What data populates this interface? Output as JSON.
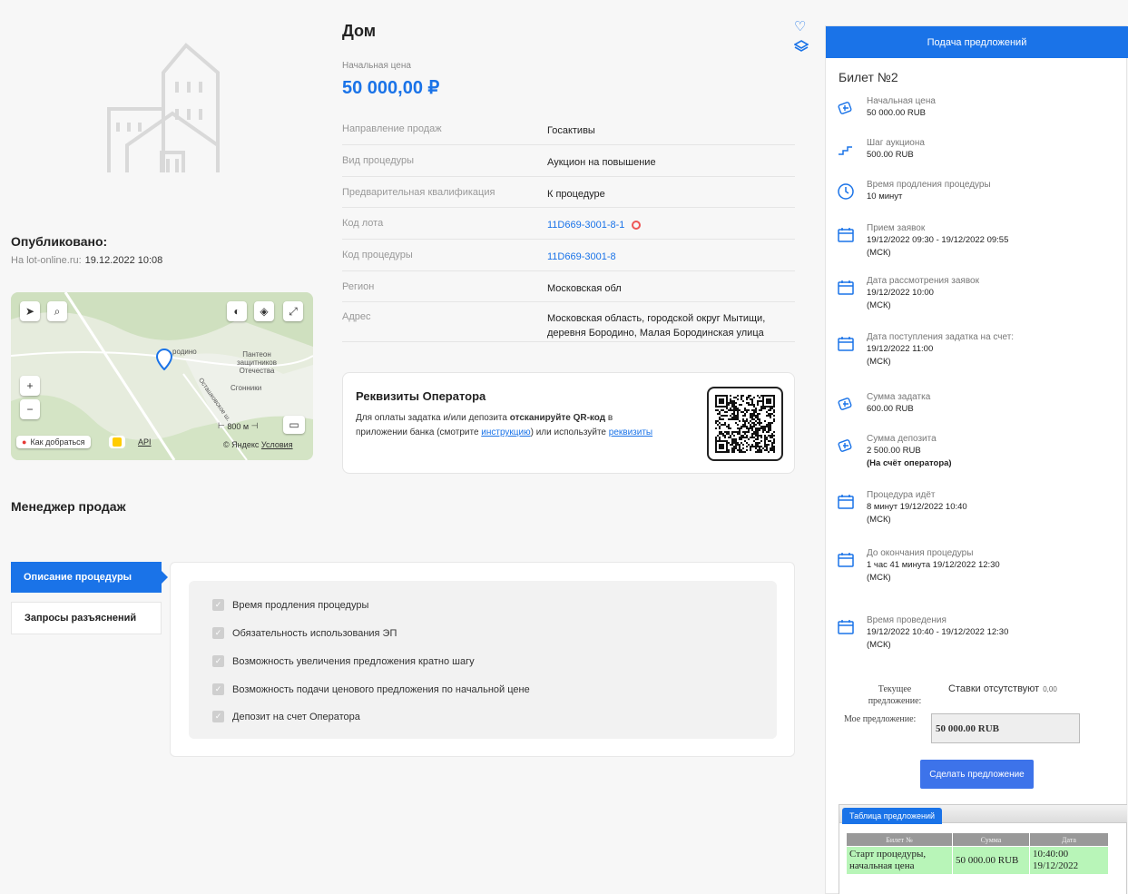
{
  "lot": {
    "title": "Дом",
    "start_price_label": "Начальная цена",
    "start_price": "50 000,00 ₽"
  },
  "published": {
    "title": "Опубликовано:",
    "source": "На lot-online.ru:",
    "date": "19.12.2022 10:08"
  },
  "map": {
    "place_borodino": "родино",
    "place_pantheon": "Пантеон защитников Отечества",
    "place_sgonniki": "Сгонники",
    "street": "Осташковское ш.",
    "scale": "800 м",
    "route_label": "Как добраться",
    "api_label": "API",
    "copyright": "© Яндекс",
    "terms_label": "Условия"
  },
  "properties": [
    {
      "key": "Направление продаж",
      "value": "Госактивы"
    },
    {
      "key": "Вид процедуры",
      "value": "Аукцион на повышение"
    },
    {
      "key": "Предварительная квалификация",
      "value": "К процедуре"
    },
    {
      "key": "Код лота",
      "value": "11D669-3001-8-1"
    },
    {
      "key": "Код процедуры",
      "value": "11D669-3001-8"
    },
    {
      "key": "Регион",
      "value": "Московская обл"
    },
    {
      "key": "Адрес",
      "value": "Московская область, городской округ Мытищи, деревня Бородино, Малая Бородинская улица"
    }
  ],
  "requisites": {
    "title": "Реквизиты Оператора",
    "text1": "Для оплаты задатка и/или депозита ",
    "text_bold": "отсканируйте QR-код",
    "text2": " в приложении банка (смотрите ",
    "link_instruction": "инструкцию",
    "text3": ") или используйте ",
    "link_requisites": "реквизиты"
  },
  "manager_title": "Менеджер продаж",
  "tabs": {
    "description": "Описание процедуры",
    "questions": "Запросы разъяснений"
  },
  "features": [
    "Время продления процедуры",
    "Обязательность использования ЭП",
    "Возможность увеличения предложения кратно шагу",
    "Возможность подачи ценового предложения по начальной цене",
    "Депозит на счет Оператора"
  ],
  "side": {
    "header": "Подача предложений",
    "ticket": "Билет №2",
    "items": [
      {
        "label": "Начальная цена",
        "value": "50 000.00 RUB",
        "icon": "money-icon"
      },
      {
        "label": "Шаг аукциона",
        "value": "500.00 RUB",
        "icon": "step-icon"
      },
      {
        "label": "Время продления процедуры",
        "value": "10 минут",
        "icon": "clock-icon"
      },
      {
        "label": "Прием заявок",
        "value": "19/12/2022 09:30 - 19/12/2022 09:55",
        "value2": "(МСК)",
        "icon": "calendar-icon"
      },
      {
        "label": "Дата рассмотрения заявок",
        "value": "19/12/2022 10:00",
        "value2": "(МСК)",
        "icon": "calendar-icon"
      },
      {
        "label": "Дата поступления задатка на счет:",
        "value": "19/12/2022 11:00",
        "value2": "(МСК)",
        "icon": "calendar-icon"
      },
      {
        "label": "Сумма задатка",
        "value": "600.00 RUB",
        "icon": "money-icon"
      },
      {
        "label": "Сумма депозита",
        "value": "2 500.00 RUB",
        "value2": "(На счёт оператора)",
        "icon": "money-icon"
      },
      {
        "label": "Процедура идёт",
        "value": "8 минут 19/12/2022 10:40",
        "value2": "(МСК)",
        "icon": "calendar-icon"
      },
      {
        "label": "До окончания процедуры",
        "value": "1 час 41 минута 19/12/2022 12:30",
        "value2": "(МСК)",
        "icon": "calendar-icon"
      },
      {
        "label": "Время проведения",
        "value": "19/12/2022 10:40 - 19/12/2022 12:30",
        "value2": "(МСК)",
        "icon": "calendar-icon"
      }
    ],
    "current_bid_label": "Текущее предложение:",
    "current_bid_value": "Ставки отсутствуют",
    "current_bid_small": "0,00",
    "my_bid_label": "Мое предложение:",
    "my_bid_value": "50 000.00 RUB",
    "make_bid_button": "Сделать предложение",
    "table_tab": "Таблица предложений",
    "table_headers": [
      "Билет №",
      "Сумма",
      "Дата"
    ],
    "table_rows": [
      {
        "ticket": "Старт процедуры, начальная цена",
        "sum": "50 000.00 RUB",
        "time": "10:40:00",
        "date": "19/12/2022"
      }
    ]
  }
}
